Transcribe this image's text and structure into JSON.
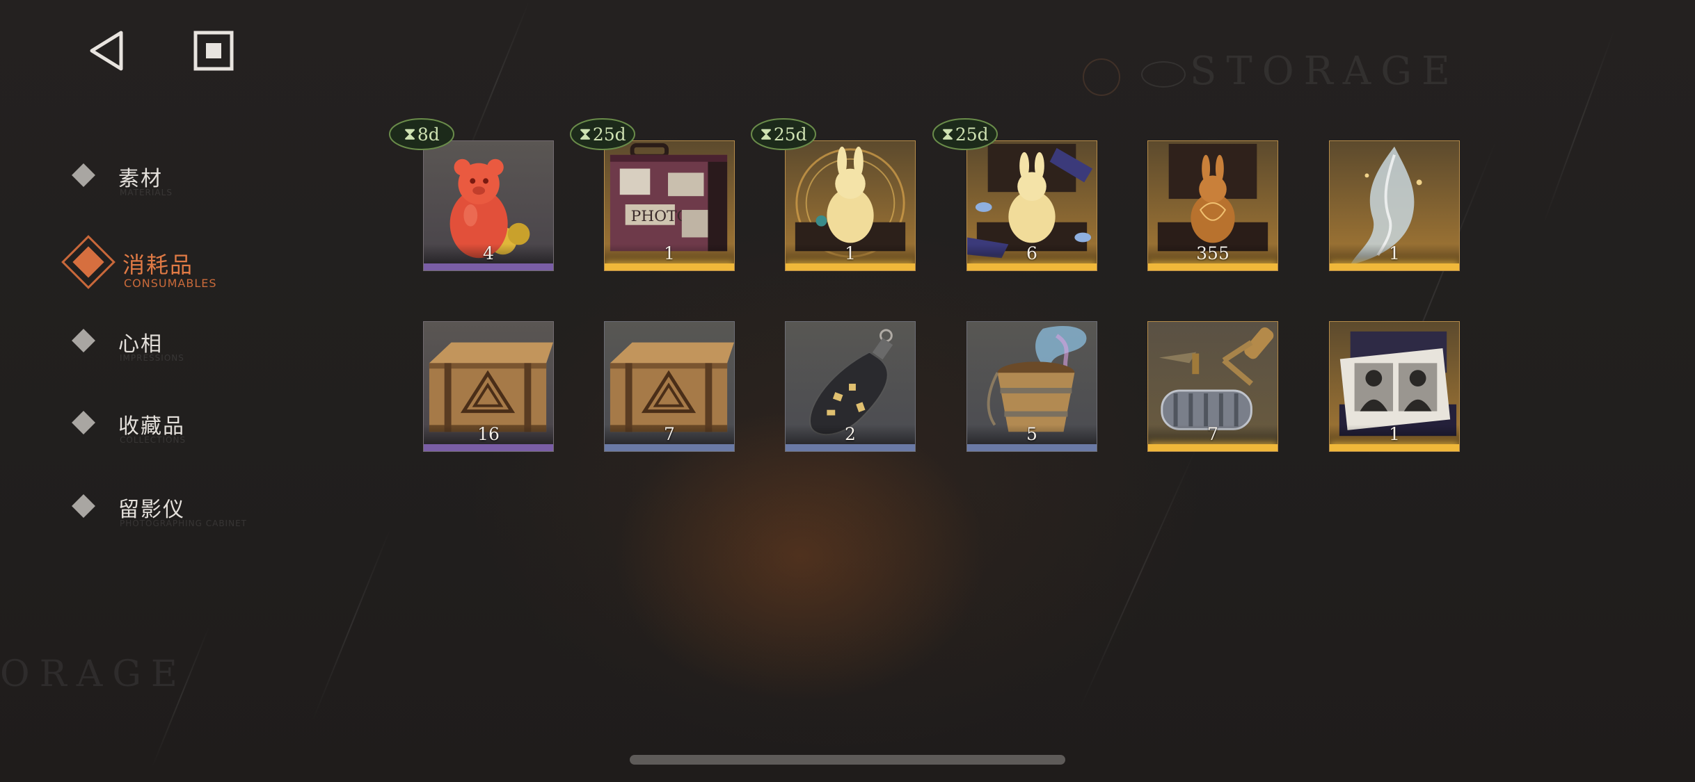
{
  "header": {
    "back_icon": "triangle-back-icon",
    "stop_icon": "square-stop-icon",
    "watermark": "STORAGE",
    "watermark_bottom": "ORAGE"
  },
  "sidebar": {
    "items": [
      {
        "label": "素材",
        "sub": "MATERIALS",
        "icon": "diamond-icon",
        "active": false
      },
      {
        "label": "消耗品",
        "sub": "CONSUMABLES",
        "icon": "diamond-icon",
        "active": true
      },
      {
        "label": "心相",
        "sub": "IMPRESSIONS",
        "icon": "diamond-icon",
        "active": false
      },
      {
        "label": "收藏品",
        "sub": "COLLECTIONS",
        "icon": "diamond-icon",
        "active": false
      },
      {
        "label": "留影仪",
        "sub": "PHOTOGRAPHING CABINET",
        "icon": "diamond-icon",
        "active": false
      }
    ]
  },
  "items": [
    {
      "name": "red-gummy-bear",
      "count": "4",
      "timer": "8d",
      "rarity": "purple"
    },
    {
      "name": "photo-suitcase",
      "count": "1",
      "timer": "25d",
      "rarity": "gold"
    },
    {
      "name": "golden-rabbit-case",
      "count": "1",
      "timer": "25d",
      "rarity": "gold"
    },
    {
      "name": "golden-rabbit-ribbon-case",
      "count": "6",
      "timer": "25d",
      "rarity": "gold"
    },
    {
      "name": "bronze-rabbit-case",
      "count": "355",
      "timer": "",
      "rarity": "gold"
    },
    {
      "name": "silver-wisp",
      "count": "1",
      "timer": "",
      "rarity": "gold"
    },
    {
      "name": "wooden-crate",
      "count": "16",
      "timer": "",
      "rarity": "purple"
    },
    {
      "name": "wooden-crate",
      "count": "7",
      "timer": "",
      "rarity": "blue"
    },
    {
      "name": "message-bottle",
      "count": "2",
      "timer": "",
      "rarity": "blue"
    },
    {
      "name": "magic-bucket",
      "count": "5",
      "timer": "",
      "rarity": "blue"
    },
    {
      "name": "paint-roller",
      "count": "7",
      "timer": "",
      "rarity": "gold"
    },
    {
      "name": "photo-album-case",
      "count": "1",
      "timer": "",
      "rarity": "gold"
    }
  ],
  "colors": {
    "accent": "#e07a45",
    "timer_green": "#cfe2b2",
    "gold_bar": "#f0b83a",
    "purple_bar": "#7a5ea6",
    "blue_bar": "#6a7aa6"
  }
}
